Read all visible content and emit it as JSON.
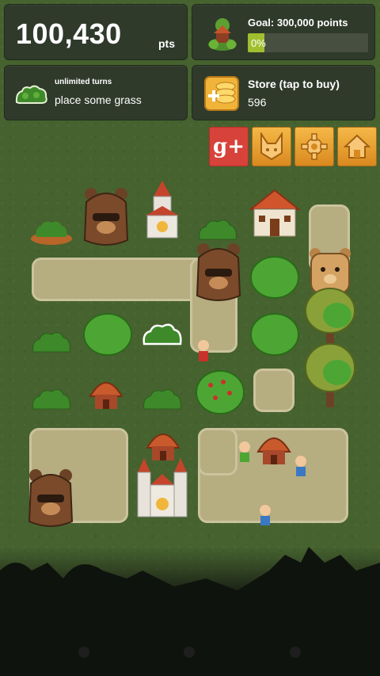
{
  "score": {
    "value": "100,430",
    "unit": "pts"
  },
  "goal": {
    "label": "Goal: 300,000 points",
    "percent_text": "0%",
    "progress": 0.0
  },
  "turns": {
    "title": "unlimited turns",
    "subtitle": "place some grass"
  },
  "store": {
    "label": "Store (tap to buy)",
    "count": "596"
  },
  "buttons": {
    "gplus_label": "g+"
  },
  "icons": {
    "goal": "house-icon",
    "turns": "grass-icon",
    "store": "coins-icon",
    "fox": "fox-icon",
    "settings": "gear-icon",
    "home": "home-icon"
  },
  "colors": {
    "panel": "#2f3a2b",
    "progress": "#9fbf2f",
    "gplus": "#d7423a",
    "orange": "#e8a232",
    "board": "#46622f",
    "path": "#b6ad81"
  }
}
